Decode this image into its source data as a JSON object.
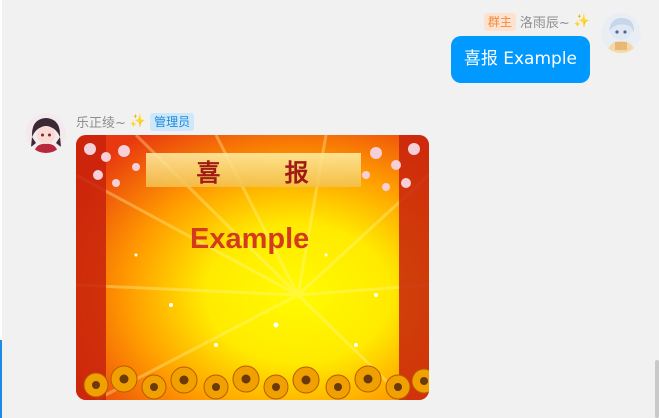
{
  "messages": [
    {
      "side": "right",
      "sender": "洛雨辰~",
      "sender_emoji": "✨",
      "role_badge": "群主",
      "text": "喜报 Example"
    },
    {
      "side": "left",
      "sender": "乐正绫~",
      "sender_emoji": "✨",
      "role_badge": "管理员",
      "image": {
        "title": "喜 报",
        "text": "Example"
      }
    }
  ],
  "colors": {
    "bubble": "#0099ff",
    "background": "#f1f1f1",
    "owner_badge": "#f08a3e",
    "admin_badge": "#1d8ad8"
  },
  "icons": [
    "sparkle-icon",
    "avatar"
  ]
}
